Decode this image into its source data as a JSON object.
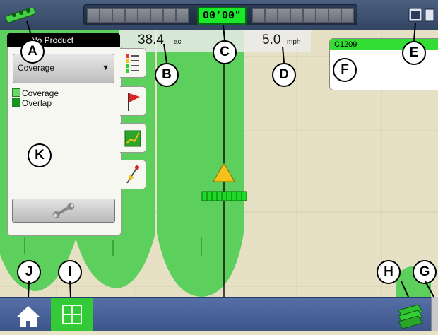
{
  "topbar": {
    "gps_icon": "gps-antenna-icon",
    "off_track": "00'00\"",
    "screen_icon": "screen-layout-icon"
  },
  "readouts": {
    "area_value": "38.4",
    "area_unit": "ac",
    "speed_value": "5.0",
    "speed_unit": "mph"
  },
  "field_panel": {
    "field_name": "C1209"
  },
  "left_panel": {
    "product_tab": "No Product",
    "dropdown_value": "Coverage",
    "legend": [
      {
        "label": "Coverage",
        "color": "#6bd76b"
      },
      {
        "label": "Overlap",
        "color": "#0d9a18"
      }
    ],
    "tool_icon": "wrench-icon"
  },
  "side_tabs": [
    "legend-icon",
    "flag-icon",
    "chart-icon",
    "marker-icon"
  ],
  "bottombar": {
    "home_icon": "home-icon",
    "map_icon": "map-grid-icon",
    "layers_icon": "layers-icon"
  },
  "callouts": {
    "a": "A",
    "b": "B",
    "c": "C",
    "d": "D",
    "e": "E",
    "f": "F",
    "g": "G",
    "h": "H",
    "i": "I",
    "j": "J",
    "k": "K"
  },
  "colors": {
    "coverage": "#5ccf5c",
    "background": "#e6e0c4",
    "active_button": "#34c936"
  }
}
